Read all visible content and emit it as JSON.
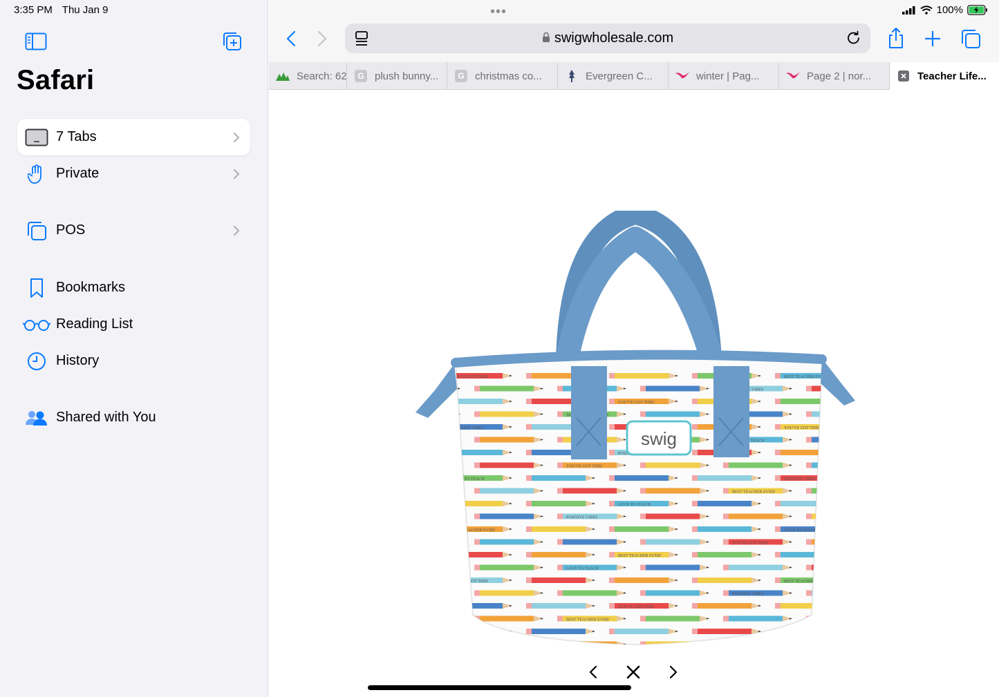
{
  "status": {
    "time": "3:35 PM",
    "date": "Thu Jan 9",
    "battery": "100%"
  },
  "sidebar": {
    "title": "Safari",
    "items": [
      {
        "label": "7 Tabs",
        "icon": "tabs-device-icon",
        "chevron": true,
        "active": true
      },
      {
        "label": "Private",
        "icon": "hand-icon",
        "chevron": true
      },
      {
        "label": "POS",
        "icon": "tab-group-icon",
        "chevron": true
      },
      {
        "label": "Bookmarks",
        "icon": "bookmark-icon"
      },
      {
        "label": "Reading List",
        "icon": "glasses-icon"
      },
      {
        "label": "History",
        "icon": "clock-icon"
      },
      {
        "label": "Shared with You",
        "icon": "people-icon"
      }
    ]
  },
  "toolbar": {
    "url": "swigwholesale.com"
  },
  "tabs": [
    {
      "title": "Search: 62",
      "favicon": "mountains",
      "color": "#3a9a3a"
    },
    {
      "title": "plush bunny...",
      "favicon": "G",
      "color": "#c7c7cc"
    },
    {
      "title": "christmas co...",
      "favicon": "G",
      "color": "#c7c7cc"
    },
    {
      "title": "Evergreen C...",
      "favicon": "tree",
      "color": "#3b4a6b"
    },
    {
      "title": "winter | Pag...",
      "favicon": "bird",
      "color": "#e0306b"
    },
    {
      "title": "Page 2 | nor...",
      "favicon": "bird",
      "color": "#e0306b"
    },
    {
      "title": "Teacher Life...",
      "favicon": "x",
      "color": "#6e6e73",
      "active": true
    }
  ],
  "product": {
    "brand_label": "swig",
    "print_phrases": [
      "YOU'VE GOT THIS!",
      "BEST TEACHER EVER!",
      "LOVE TO TEACH",
      "POSITIVE VIBES"
    ]
  },
  "colors": {
    "accent": "#0a7aff",
    "handle": "#6b9bc8"
  }
}
